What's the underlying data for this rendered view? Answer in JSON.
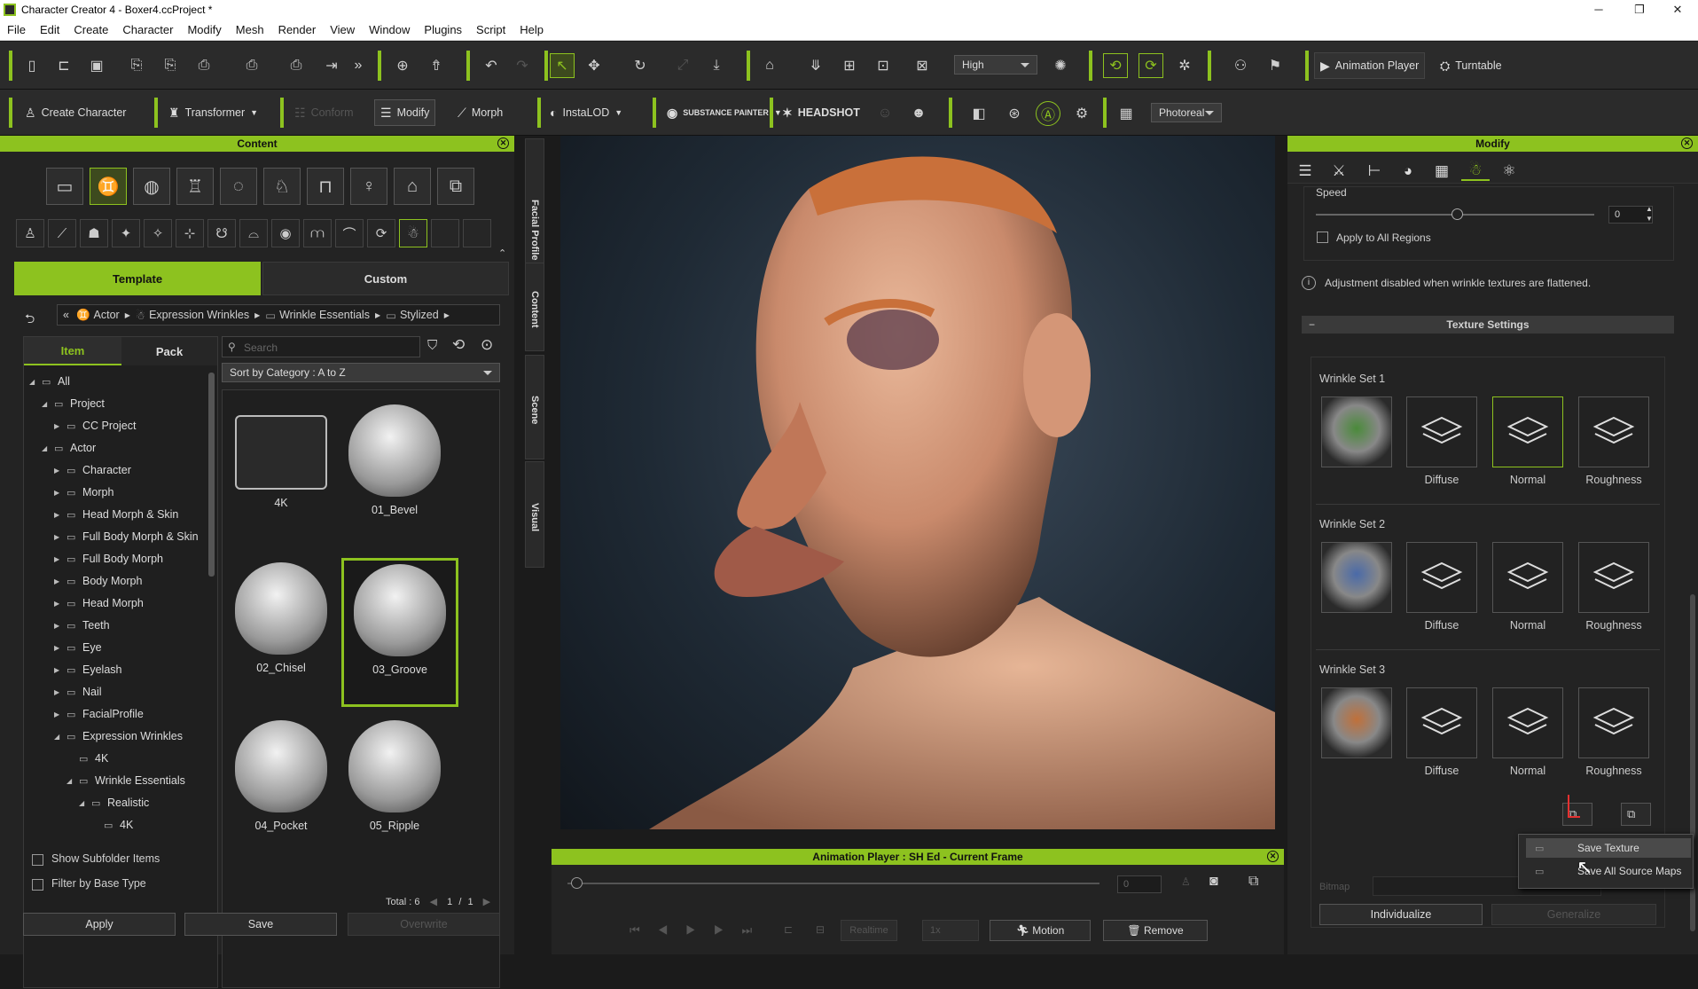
{
  "window": {
    "title": "Character Creator 4 - Boxer4.ccProject *",
    "minimize": "─",
    "maximize": "❐",
    "close": "✕"
  },
  "menu": [
    "File",
    "Edit",
    "Create",
    "Character",
    "Modify",
    "Mesh",
    "Render",
    "View",
    "Window",
    "Plugins",
    "Script",
    "Help"
  ],
  "toolbar1": {
    "quality": "High",
    "animation_player": "Animation Player",
    "turntable": "Turntable"
  },
  "toolbar2": {
    "create_character": "Create Character",
    "transformer": "Transformer",
    "conform": "Conform",
    "modify": "Modify",
    "morph": "Morph",
    "instalod": "InstaLOD",
    "substance": "SUBSTANCE PAINTER",
    "headshot": "HEADSHOT",
    "render_mode": "Photoreal"
  },
  "content": {
    "title": "Content",
    "tabs": {
      "template": "Template",
      "custom": "Custom"
    },
    "breadcrumb": [
      "Actor",
      "Expression Wrinkles",
      "Wrinkle Essentials",
      "Stylized"
    ],
    "subtabs": {
      "item": "Item",
      "pack": "Pack"
    },
    "search_placeholder": "Search",
    "sort": "Sort by Category : A to Z",
    "tree": [
      {
        "label": "All",
        "level": 0,
        "arrow": "◢"
      },
      {
        "label": "Project",
        "level": 1,
        "arrow": "◢"
      },
      {
        "label": "CC Project",
        "level": 2,
        "arrow": "▶"
      },
      {
        "label": "Actor",
        "level": 1,
        "arrow": "◢"
      },
      {
        "label": "Character",
        "level": 2,
        "arrow": "▶"
      },
      {
        "label": "Morph",
        "level": 2,
        "arrow": "▶"
      },
      {
        "label": "Head Morph & Skin",
        "level": 2,
        "arrow": "▶"
      },
      {
        "label": "Full Body Morph & Skin",
        "level": 2,
        "arrow": "▶"
      },
      {
        "label": "Full Body Morph",
        "level": 2,
        "arrow": "▶"
      },
      {
        "label": "Body Morph",
        "level": 2,
        "arrow": "▶"
      },
      {
        "label": "Head Morph",
        "level": 2,
        "arrow": "▶"
      },
      {
        "label": "Teeth",
        "level": 2,
        "arrow": "▶"
      },
      {
        "label": "Eye",
        "level": 2,
        "arrow": "▶"
      },
      {
        "label": "Eyelash",
        "level": 2,
        "arrow": "▶"
      },
      {
        "label": "Nail",
        "level": 2,
        "arrow": "▶"
      },
      {
        "label": "FacialProfile",
        "level": 2,
        "arrow": "▶"
      },
      {
        "label": "Expression Wrinkles",
        "level": 2,
        "arrow": "◢"
      },
      {
        "label": "4K",
        "level": 3,
        "arrow": ""
      },
      {
        "label": "Wrinkle Essentials",
        "level": 3,
        "arrow": "◢"
      },
      {
        "label": "Realistic",
        "level": 4,
        "arrow": "◢"
      },
      {
        "label": "4K",
        "level": 5,
        "arrow": ""
      }
    ],
    "items": [
      "4K",
      "01_Bevel",
      "02_Chisel",
      "03_Groove",
      "04_Pocket",
      "05_Ripple"
    ],
    "show_subfolder": "Show Subfolder Items",
    "filter_base": "Filter by Base Type",
    "total": "Total : 6",
    "page": "1",
    "page_sep": "/",
    "page_total": "1",
    "apply": "Apply",
    "save": "Save",
    "overwrite": "Overwrite"
  },
  "side_tabs": [
    "Facial Profile Editor",
    "Content",
    "Scene",
    "Visual"
  ],
  "anim": {
    "title": "Animation Player : SH Ed - Current Frame",
    "frame": "0",
    "realtime": "Realtime",
    "speed": "1x",
    "motion": "Motion",
    "remove": "Remove"
  },
  "modify": {
    "title": "Modify",
    "speed_label": "Speed",
    "speed_value": "0",
    "apply_all": "Apply to All Regions",
    "info": "Adjustment disabled when wrinkle textures are flattened.",
    "texture_settings": "Texture Settings",
    "sets": [
      "Wrinkle Set 1",
      "Wrinkle Set 2",
      "Wrinkle Set 3"
    ],
    "maps": [
      "Diffuse",
      "Normal",
      "Roughness"
    ],
    "bitmap": "Bitmap",
    "individualize": "Individualize",
    "generalize": "Generalize"
  },
  "context_menu": {
    "save_texture": "Save Texture",
    "save_all": "Save All Source Maps"
  },
  "colors": {
    "accent": "#8dc21f"
  }
}
